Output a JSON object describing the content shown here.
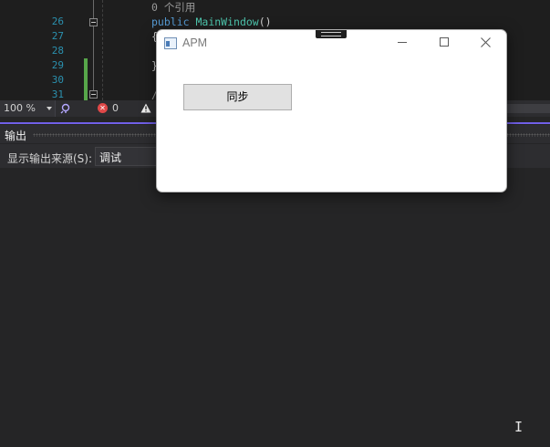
{
  "editor": {
    "lines": [
      {
        "num": "",
        "code_kind": "comment",
        "text": "0 个引用"
      },
      {
        "num": "26",
        "code_kind": "decl",
        "kw": "public",
        "type": "MainWindow",
        "tail": "()"
      },
      {
        "num": "27",
        "code_kind": "plain",
        "text": "{"
      },
      {
        "num": "28",
        "code_kind": "plain",
        "text": ""
      },
      {
        "num": "29",
        "code_kind": "plain",
        "text": "}"
      },
      {
        "num": "30",
        "code_kind": "plain",
        "text": ""
      },
      {
        "num": "31",
        "code_kind": "plain",
        "text": "/"
      }
    ],
    "accent_color": "#7160e8"
  },
  "status_strip": {
    "zoom": "100 %",
    "error_count": "0",
    "icons": [
      "intellicode-icon",
      "error-icon",
      "warning-icon"
    ]
  },
  "output_panel": {
    "title": "输出",
    "source_label": "显示输出来源(S):",
    "source_value": "调试"
  },
  "apm_window": {
    "title": "APM",
    "sync_button": "同步"
  }
}
